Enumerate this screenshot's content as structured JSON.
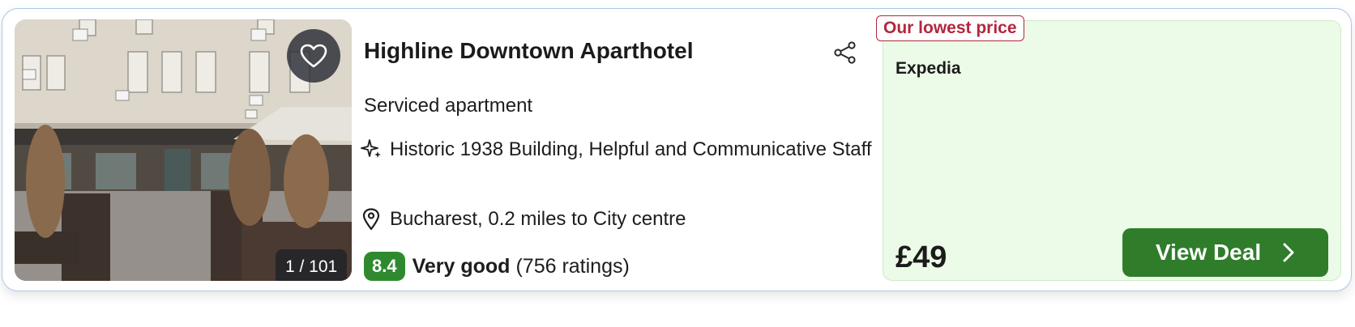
{
  "hotel": {
    "name": "Highline Downtown Aparthotel",
    "type": "Serviced apartment",
    "highlights": "Historic 1938 Building, Helpful and Communicative Staff",
    "location": "Bucharest, 0.2 miles to City centre",
    "photo_counter": "1 / 101",
    "rating": {
      "score": "8.4",
      "label": "Very good",
      "count": "(756 ratings)"
    }
  },
  "deal": {
    "badge": "Our lowest price",
    "provider": "Expedia",
    "price": "£49",
    "button_label": "View Deal"
  },
  "icons": {
    "favorite": "heart-icon",
    "share": "share-icon",
    "highlights": "sparkle-icon",
    "location": "map-pin-icon",
    "button": "chevron-right-icon"
  },
  "colors": {
    "score_badge": "#2f8a2f",
    "deal_button": "#2f7d2a",
    "deal_panel": "#ecfbe8",
    "lowest_badge": "#b3263f",
    "card_border": "#a9c8e8"
  }
}
